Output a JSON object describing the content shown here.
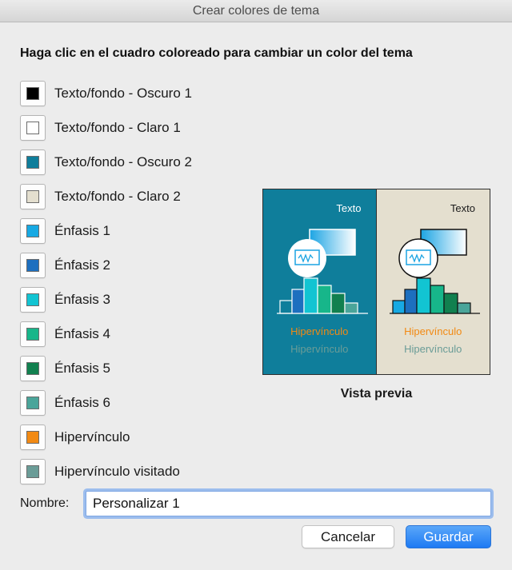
{
  "window": {
    "title": "Crear colores de tema"
  },
  "instruction": "Haga clic en el cuadro coloreado para cambiar un color del tema",
  "colors": [
    {
      "label": "Texto/fondo - Oscuro 1",
      "color": "#000000"
    },
    {
      "label": "Texto/fondo - Claro 1",
      "color": "#ffffff"
    },
    {
      "label": "Texto/fondo - Oscuro 2",
      "color": "#0f7e9b"
    },
    {
      "label": "Texto/fondo - Claro 2",
      "color": "#e4dfcf"
    },
    {
      "label": "Énfasis 1",
      "color": "#17a9e3"
    },
    {
      "label": "Énfasis 2",
      "color": "#1d6fbf"
    },
    {
      "label": "Énfasis 3",
      "color": "#12c4d2"
    },
    {
      "label": "Énfasis 4",
      "color": "#17b68a"
    },
    {
      "label": "Énfasis 5",
      "color": "#11804f"
    },
    {
      "label": "Énfasis 6",
      "color": "#4aa59a"
    },
    {
      "label": "Hipervínculo",
      "color": "#f28a14"
    },
    {
      "label": "Hipervínculo visitado",
      "color": "#6a9c97"
    }
  ],
  "preview": {
    "caption": "Vista previa",
    "dark": {
      "text": "Texto",
      "hyperlink": "Hipervínculo",
      "visited": "Hipervínculo"
    },
    "light": {
      "text": "Texto",
      "hyperlink": "Hipervínculo",
      "visited": "Hipervínculo"
    }
  },
  "name_field": {
    "label": "Nombre:",
    "value": "Personalizar 1"
  },
  "buttons": {
    "cancel": "Cancelar",
    "save": "Guardar"
  }
}
